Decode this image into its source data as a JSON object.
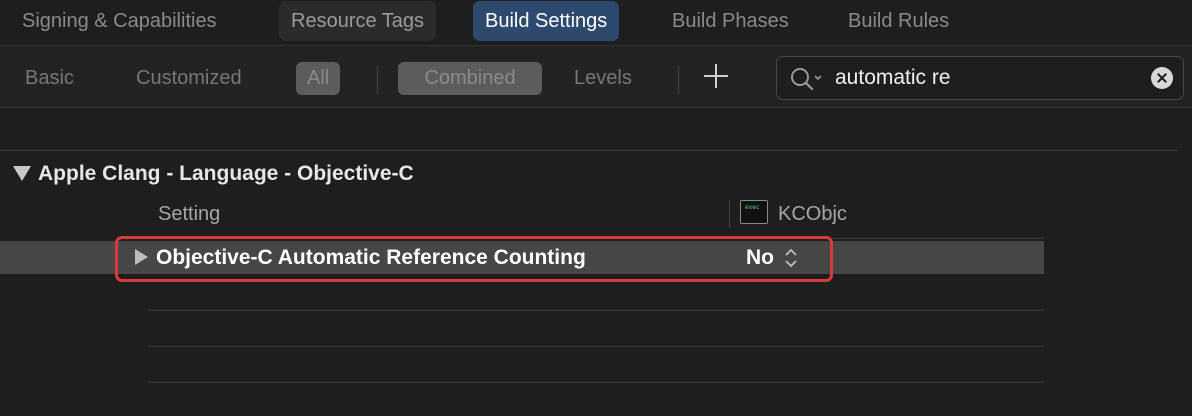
{
  "tabs": [
    {
      "label": "Signing & Capabilities",
      "state": "normal"
    },
    {
      "label": "Resource Tags",
      "state": "boxed"
    },
    {
      "label": "Build Settings",
      "state": "selected"
    },
    {
      "label": "Build Phases",
      "state": "normal"
    },
    {
      "label": "Build Rules",
      "state": "normal"
    }
  ],
  "filters": {
    "basic": "Basic",
    "customized": "Customized",
    "all": "All",
    "combined": "Combined",
    "levels": "Levels"
  },
  "search": {
    "value": "automatic re"
  },
  "section": {
    "title": "Apple Clang - Language - Objective-C",
    "column_setting": "Setting",
    "target_name": "KCObjc",
    "target_icon_text": "exec"
  },
  "setting_row": {
    "label": "Objective-C Automatic Reference Counting",
    "value": "No"
  },
  "colors": {
    "selected_tab": "#2d4a6e",
    "highlight": "#d63c3c",
    "selected_row": "#464646"
  }
}
